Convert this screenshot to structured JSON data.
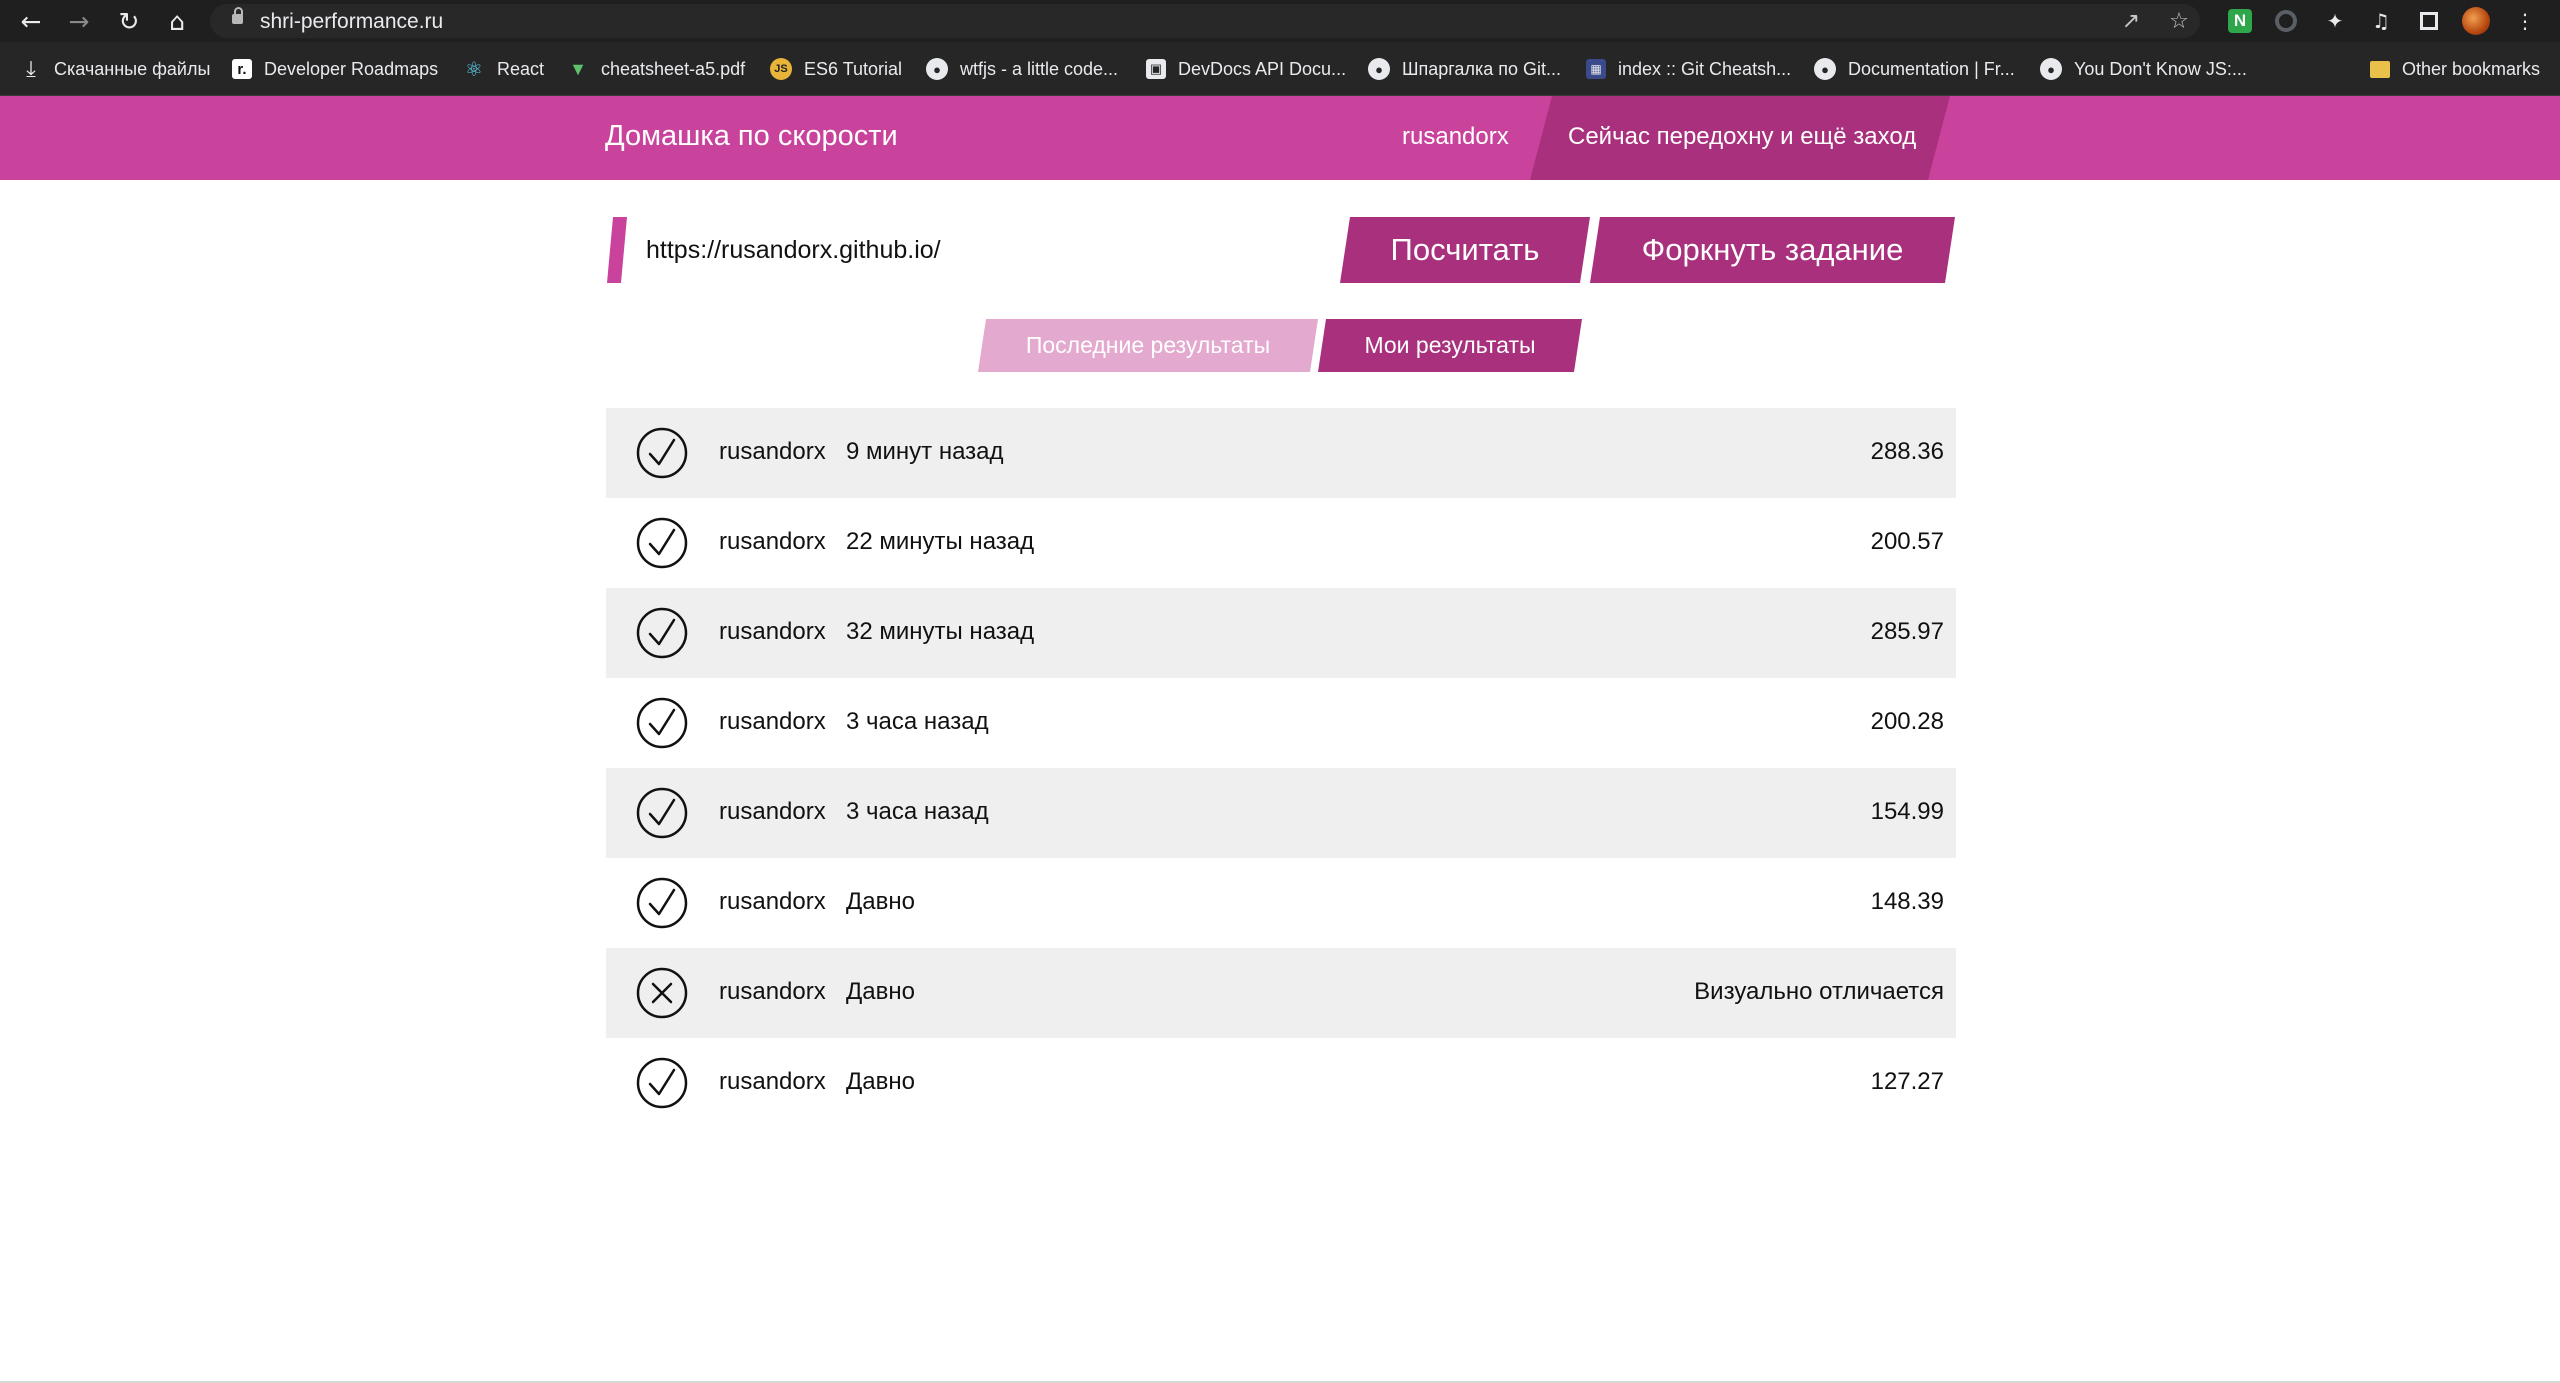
{
  "browser": {
    "url": "shri-performance.ru",
    "bookmarks": [
      {
        "label": "Скачанные файлы",
        "icon": "download-icon"
      },
      {
        "label": "Developer Roadmaps",
        "icon": "roadmap-icon"
      },
      {
        "label": "React",
        "icon": "react-icon"
      },
      {
        "label": "cheatsheet-a5.pdf",
        "icon": "vue-icon"
      },
      {
        "label": "ES6 Tutorial",
        "icon": "js-icon"
      },
      {
        "label": "wtfjs - a little code...",
        "icon": "globe-icon"
      },
      {
        "label": "DevDocs API Docu...",
        "icon": "devdocs-icon"
      },
      {
        "label": "Шпаргалка по Git...",
        "icon": "globe-icon"
      },
      {
        "label": "index :: Git Cheatsh...",
        "icon": "page-icon"
      },
      {
        "label": "Documentation | Fr...",
        "icon": "globe-icon"
      },
      {
        "label": "You Don't Know JS:...",
        "icon": "globe-icon"
      }
    ],
    "other_bookmarks": "Other bookmarks"
  },
  "header": {
    "title": "Домашка по скорости",
    "user": "rusandorx",
    "pause_label": "Сейчас передохну и ещё заход"
  },
  "form": {
    "url_value": "https://rusandorx.github.io/",
    "calc_label": "Посчитать",
    "fork_label": "Форкнуть задание"
  },
  "tabs": {
    "recent": "Последние результаты",
    "mine": "Мои результаты"
  },
  "colors": {
    "header": "#c9439d",
    "button": "#a8307d",
    "tab_inactive": "#e3a9cf"
  },
  "results": [
    {
      "status": "success",
      "user": "rusandorx",
      "time": "9 минут назад",
      "score": "288.36"
    },
    {
      "status": "success",
      "user": "rusandorx",
      "time": "22 минуты назад",
      "score": "200.57"
    },
    {
      "status": "success",
      "user": "rusandorx",
      "time": "32 минуты назад",
      "score": "285.97"
    },
    {
      "status": "success",
      "user": "rusandorx",
      "time": "3 часа назад",
      "score": "200.28"
    },
    {
      "status": "success",
      "user": "rusandorx",
      "time": "3 часа назад",
      "score": "154.99"
    },
    {
      "status": "success",
      "user": "rusandorx",
      "time": "Давно",
      "score": "148.39"
    },
    {
      "status": "fail",
      "user": "rusandorx",
      "time": "Давно",
      "score": "Визуально отличается"
    },
    {
      "status": "success",
      "user": "rusandorx",
      "time": "Давно",
      "score": "127.27"
    }
  ]
}
